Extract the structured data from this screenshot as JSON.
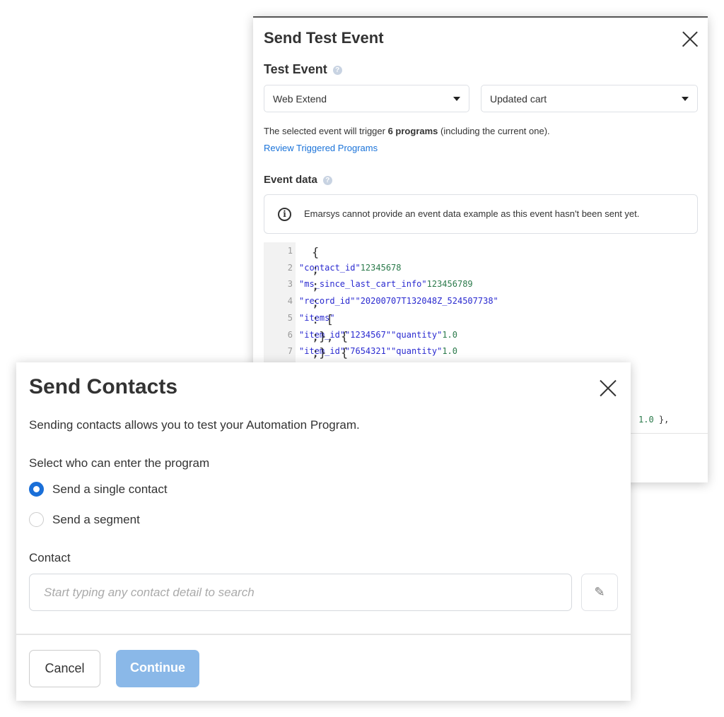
{
  "test_event_dialog": {
    "title": "Send Test Event",
    "section_title": "Test Event",
    "help_glyph": "?",
    "platform_select": "Web Extend",
    "event_select": "Updated cart",
    "trigger_text_pre": "The selected event will trigger ",
    "trigger_count": "6 programs",
    "trigger_text_post": " (including the current one).",
    "review_link": "Review Triggered Programs",
    "event_data_title": "Event data",
    "info_glyph": "i",
    "info_message": "Emarsys cannot provide an event data example as this event hasn't been sent yet.",
    "code_lines": [
      {
        "n": "1",
        "tokens": [
          [
            "p",
            "{"
          ]
        ]
      },
      {
        "n": "2",
        "tokens": [
          [
            "p",
            "  "
          ],
          [
            "k",
            "\"contact_id\""
          ],
          [
            "p",
            ": "
          ],
          [
            "n",
            "12345678"
          ],
          [
            "p",
            ","
          ]
        ]
      },
      {
        "n": "3",
        "tokens": [
          [
            "p",
            "  "
          ],
          [
            "k",
            "\"ms_since_last_cart_info\""
          ],
          [
            "p",
            ": "
          ],
          [
            "n",
            "123456789"
          ],
          [
            "p",
            ","
          ]
        ]
      },
      {
        "n": "4",
        "tokens": [
          [
            "p",
            "  "
          ],
          [
            "k",
            "\"record_id\""
          ],
          [
            "p",
            ": "
          ],
          [
            "s",
            "\"20200707T132048Z_524507738\""
          ],
          [
            "p",
            ","
          ]
        ]
      },
      {
        "n": "5",
        "tokens": [
          [
            "p",
            "  "
          ],
          [
            "k",
            "\"items\""
          ],
          [
            "p",
            ": ["
          ]
        ]
      },
      {
        "n": "6",
        "tokens": [
          [
            "p",
            "    { "
          ],
          [
            "k",
            "\"item_id\""
          ],
          [
            "p",
            ": "
          ],
          [
            "s",
            "\"1234567\""
          ],
          [
            "p",
            ", "
          ],
          [
            "k",
            "\"quantity\""
          ],
          [
            "p",
            ": "
          ],
          [
            "n",
            "1.0"
          ],
          [
            "p",
            " },"
          ]
        ]
      },
      {
        "n": "7",
        "tokens": [
          [
            "p",
            "    { "
          ],
          [
            "k",
            "\"item_id\""
          ],
          [
            "p",
            ": "
          ],
          [
            "s",
            "\"7654321\""
          ],
          [
            "p",
            ", "
          ],
          [
            "k",
            "\"quantity\""
          ],
          [
            "p",
            ": "
          ],
          [
            "n",
            "1.0"
          ],
          [
            "p",
            " }"
          ]
        ]
      }
    ],
    "code_fragment_value": "1.0",
    "code_fragment_tail": " },"
  },
  "send_contacts_dialog": {
    "title": "Send Contacts",
    "description": "Sending contacts allows you to test your Automation Program.",
    "select_label": "Select who can enter the program",
    "options": [
      {
        "label": "Send a single contact",
        "selected": true
      },
      {
        "label": "Send a segment",
        "selected": false
      }
    ],
    "contact_label": "Contact",
    "contact_placeholder": "Start typing any contact detail to search",
    "edit_icon": "pencil-icon",
    "cancel_label": "Cancel",
    "continue_label": "Continue"
  },
  "colors": {
    "accent": "#1a6fd8",
    "link": "#1a73d9",
    "continue_disabled": "#8ab8e8",
    "json_key": "#2a2ad0",
    "json_number": "#2b7a4b"
  }
}
